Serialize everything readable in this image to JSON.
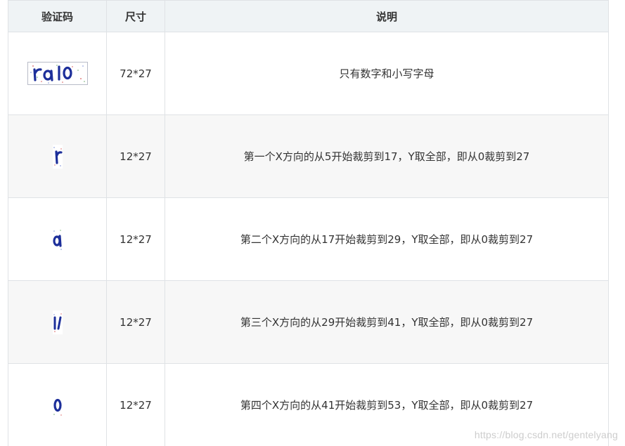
{
  "table": {
    "headers": [
      "验证码",
      "尺寸",
      "说明"
    ],
    "rows": [
      {
        "image": "captcha-full-image",
        "size": "72*27",
        "description": "只有数字和小写字母"
      },
      {
        "image": "captcha-char-1-image",
        "size": "12*27",
        "description": "第一个X方向的从5开始裁剪到17，Y取全部，即从0裁剪到27"
      },
      {
        "image": "captcha-char-2-image",
        "size": "12*27",
        "description": "第二个X方向的从17开始裁剪到29，Y取全部，即从0裁剪到27"
      },
      {
        "image": "captcha-char-3-image",
        "size": "12*27",
        "description": "第三个X方向的从29开始裁剪到41，Y取全部，即从0裁剪到27"
      },
      {
        "image": "captcha-char-4-image",
        "size": "12*27",
        "description": "第四个X方向的从41开始裁剪到53，Y取全部，即从0裁剪到27"
      }
    ]
  },
  "watermark": "https://blog.csdn.net/gentelyang",
  "colors": {
    "header_bg": "#eff3f5",
    "stripe_bg": "#f7f7f7",
    "border": "#dfe2e5",
    "captcha_ink": "#1d2f9a"
  }
}
